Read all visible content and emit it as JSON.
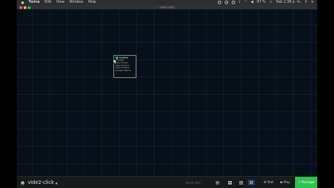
{
  "menubar": {
    "items": [
      "Twine",
      "Edit",
      "View",
      "Window",
      "Help"
    ],
    "battery": "97 %",
    "clock": "Sáb 1:38 p. m."
  },
  "window": {
    "title": "vide2-click"
  },
  "passage": {
    "title": "Untitled",
    "excerpt_lines": [
      "Passage",
      "select timer",
      "select timers",
      "select timers",
      "(simple select)"
    ]
  },
  "bottombar": {
    "story_name": "vide2-click",
    "quick_find_placeholder": "Quick Find",
    "text_label": "Text",
    "play_label": "Play",
    "new_passage_label": "+ Passage"
  },
  "colors": {
    "canvas": "#07101a",
    "accent_green": "#2ec44f",
    "active_button": "#1f3f70"
  }
}
